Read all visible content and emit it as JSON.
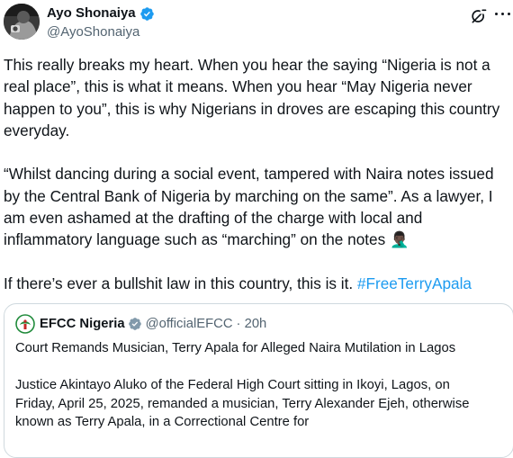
{
  "author": {
    "name": "Ayo Shonaiya",
    "handle": "@AyoShonaiya"
  },
  "tweet": {
    "lines_p1": [
      "This really breaks my heart. When you hear the saying “Nigeria is not a",
      "real place”, this is what it means. When you hear “May Nigeria never",
      "happen to you”, this is why Nigerians in droves are escaping this country",
      "everyday."
    ],
    "lines_p2": [
      "“Whilst dancing during a social event, tampered with Naira notes issued",
      "by the Central Bank of Nigeria by marching on the same”. As a lawyer, I",
      "am even ashamed at the drafting of the charge with local and",
      "inflammatory language such as “marching” on the notes"
    ],
    "p2_emoji": "🤦🏿‍♂️",
    "p3_text": "If there’s ever a bullshit law in this country, this is it. ",
    "hashtag": "#FreeTerryApala"
  },
  "quote": {
    "name": "EFCC Nigeria",
    "handle": "@officialEFCC",
    "time": "· 20h",
    "title": "Court Remands Musician, Terry Apala  for Alleged Naira Mutilation in Lagos",
    "body_lines": [
      "Justice Akintayo Aluko of the Federal High Court sitting in Ikoyi, Lagos, on",
      "Friday, April 25, 2025, remanded a musician, Terry Alexander Ejeh, otherwise",
      "known as Terry Apala, in a Correctional Centre for"
    ]
  },
  "icons": {
    "verified": "verified-badge-icon",
    "grok": "grok-icon",
    "more": "more-options-icon"
  },
  "colors": {
    "link": "#1d9bf0",
    "muted": "#536471",
    "verified_blue": "#1d9bf0",
    "verified_gray": "#829aab",
    "efcc_green": "#1f8a3a"
  }
}
